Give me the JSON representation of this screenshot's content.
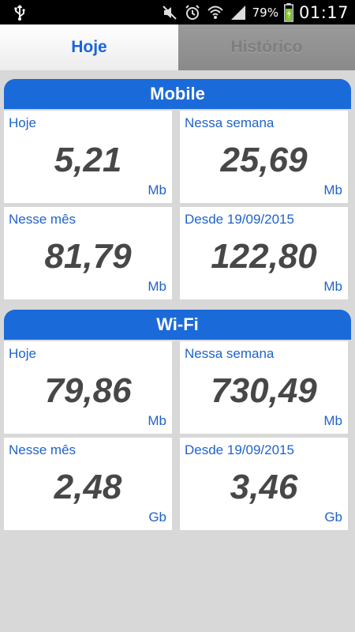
{
  "status_bar": {
    "left_icon": "usb-icon",
    "icons": [
      "mute-icon",
      "alarm-icon",
      "wifi-icon",
      "signal-icon"
    ],
    "battery_percent": "79%",
    "battery_icon": "battery-charging-icon",
    "time": "01:17"
  },
  "tabs": [
    {
      "label": "Hoje",
      "active": true
    },
    {
      "label": "Histórico",
      "active": false
    }
  ],
  "sections": [
    {
      "title": "Mobile",
      "cards": [
        {
          "label": "Hoje",
          "value": "5,21",
          "unit": "Mb"
        },
        {
          "label": "Nessa semana",
          "value": "25,69",
          "unit": "Mb"
        },
        {
          "label": "Nesse mês",
          "value": "81,79",
          "unit": "Mb"
        },
        {
          "label": "Desde 19/09/2015",
          "value": "122,80",
          "unit": "Mb"
        }
      ]
    },
    {
      "title": "Wi-Fi",
      "cards": [
        {
          "label": "Hoje",
          "value": "79,86",
          "unit": "Mb"
        },
        {
          "label": "Nessa semana",
          "value": "730,49",
          "unit": "Mb"
        },
        {
          "label": "Nesse mês",
          "value": "2,48",
          "unit": "Gb"
        },
        {
          "label": "Desde 19/09/2015",
          "value": "3,46",
          "unit": "Gb"
        }
      ]
    }
  ],
  "colors": {
    "accent": "#1a6ad9",
    "label": "#1f63c9",
    "value": "#474747",
    "background": "#d8d8d8"
  }
}
